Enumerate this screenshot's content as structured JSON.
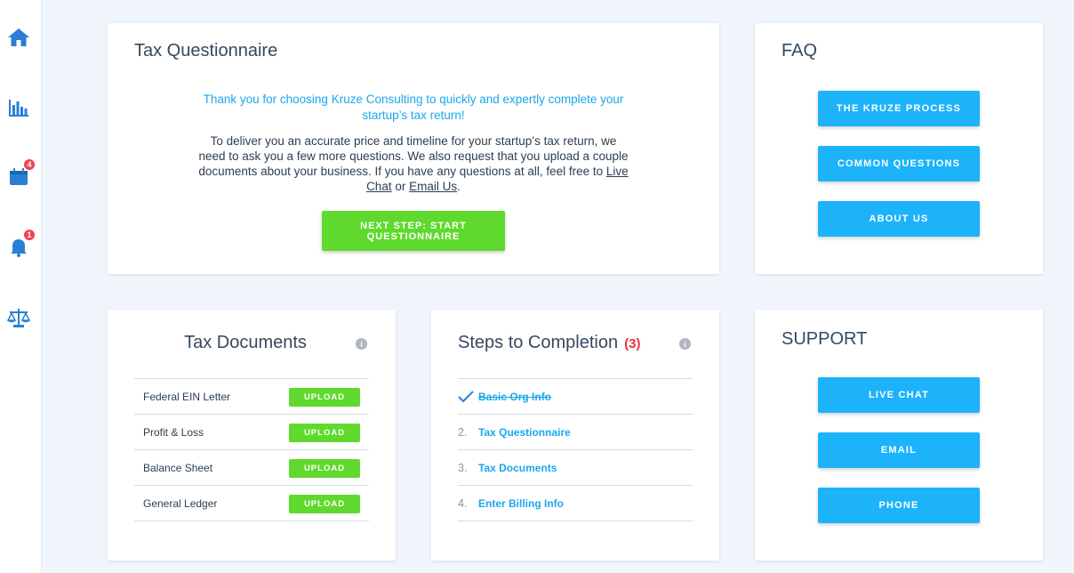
{
  "sidebar": {
    "items": [
      {
        "icon": "home-icon",
        "badge": null
      },
      {
        "icon": "bar-chart-icon",
        "badge": null
      },
      {
        "icon": "calendar-icon",
        "badge": "4"
      },
      {
        "icon": "bell-icon",
        "badge": "1"
      },
      {
        "icon": "scales-icon",
        "badge": null
      }
    ]
  },
  "questionnaire": {
    "title": "Tax Questionnaire",
    "intro_blue": "Thank you for choosing Kruze Consulting to quickly and expertly complete your startup’s tax return!",
    "intro_text_1": "To deliver you an accurate price and timeline for your startup’s tax return, we need to ask you a few more questions. We also request that you upload a couple documents about your business. If you have any questions at all, feel free to",
    "live_chat_link": "Live Chat",
    "or_text": "or",
    "email_link": "Email Us",
    "period": ".",
    "next_step_label": "NEXT STEP: START QUESTIONNAIRE"
  },
  "faq": {
    "title": "FAQ",
    "buttons": [
      "THE KRUZE PROCESS",
      "COMMON QUESTIONS",
      "ABOUT US"
    ]
  },
  "tax_documents": {
    "title": "Tax Documents",
    "upload_label": "UPLOAD",
    "rows": [
      "Federal EIN Letter",
      "Profit & Loss",
      "Balance Sheet",
      "General Ledger"
    ]
  },
  "steps": {
    "title": "Steps to Completion",
    "count": "(3)",
    "items": [
      {
        "num": "",
        "label": "Basic Org Info",
        "done": true
      },
      {
        "num": "2.",
        "label": "Tax Questionnaire",
        "done": false
      },
      {
        "num": "3.",
        "label": "Tax Documents",
        "done": false
      },
      {
        "num": "4.",
        "label": "Enter Billing Info",
        "done": false
      }
    ]
  },
  "support": {
    "title": "SUPPORT",
    "buttons": [
      "LIVE CHAT",
      "EMAIL",
      "PHONE"
    ]
  },
  "colors": {
    "accent_blue": "#1cb3fb",
    "green": "#5fd92d",
    "badge_red": "#f0424e",
    "count_red": "#e8313d"
  }
}
